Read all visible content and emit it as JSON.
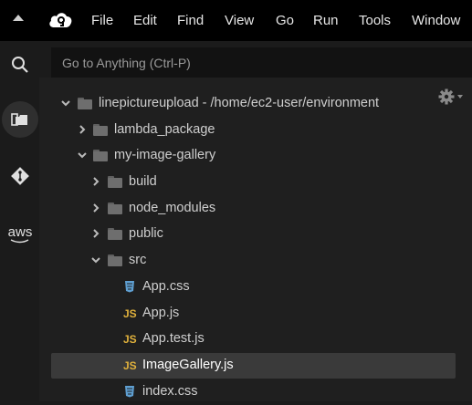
{
  "menubar": {
    "items": [
      "File",
      "Edit",
      "Find",
      "View",
      "Go",
      "Run",
      "Tools",
      "Window"
    ]
  },
  "search": {
    "placeholder": "Go to Anything (Ctrl-P)"
  },
  "rail": {
    "aws_label": "aws"
  },
  "tree": {
    "root": {
      "name": "linepictureupload",
      "path": " - /home/ec2-user/environment"
    },
    "items": [
      {
        "name": "lambda_package",
        "type": "folder",
        "expanded": false
      },
      {
        "name": "my-image-gallery",
        "type": "folder",
        "expanded": true
      },
      {
        "name": "build",
        "type": "folder",
        "expanded": false
      },
      {
        "name": "node_modules",
        "type": "folder",
        "expanded": false
      },
      {
        "name": "public",
        "type": "folder",
        "expanded": false
      },
      {
        "name": "src",
        "type": "folder",
        "expanded": true
      },
      {
        "name": "App.css",
        "type": "css"
      },
      {
        "name": "App.js",
        "type": "js"
      },
      {
        "name": "App.test.js",
        "type": "js"
      },
      {
        "name": "ImageGallery.js",
        "type": "js",
        "selected": true
      },
      {
        "name": "index.css",
        "type": "css"
      }
    ],
    "js_badge": "JS"
  },
  "colors": {
    "js": "#e0b13c",
    "css": "#5f9fd1",
    "selected_row": "#3a3a3a"
  }
}
